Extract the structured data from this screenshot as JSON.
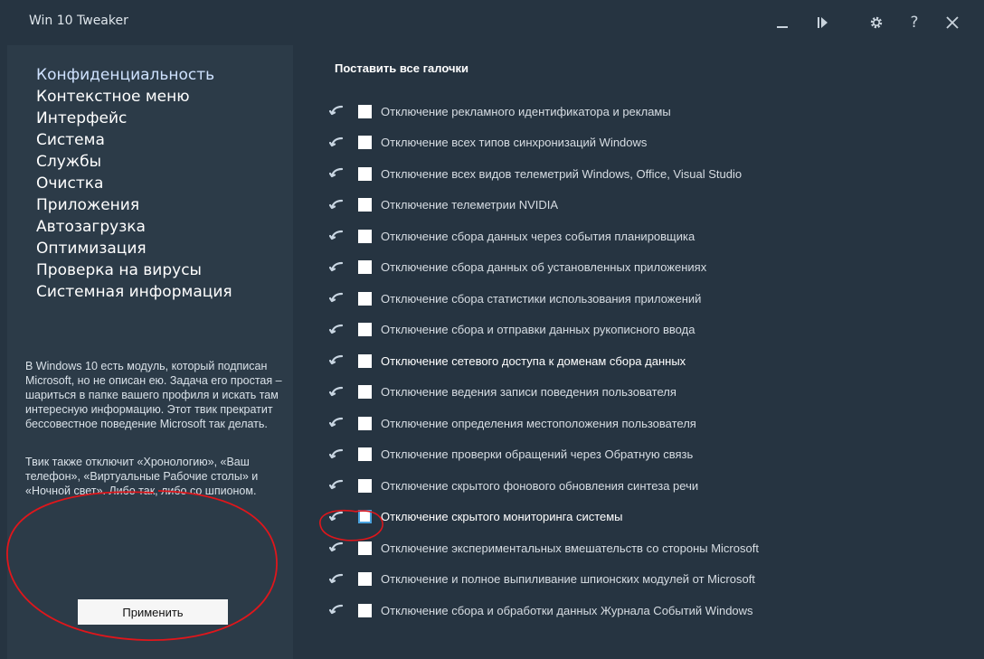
{
  "window": {
    "title": "Win 10 Tweaker"
  },
  "titlebar": {
    "buttons": [
      {
        "name": "minimize-icon"
      },
      {
        "name": "run-icon"
      },
      {
        "name": "gear-icon"
      },
      {
        "name": "help-icon"
      },
      {
        "name": "close-icon"
      }
    ]
  },
  "sidebar": {
    "items": [
      {
        "label": "Конфиденциальность"
      },
      {
        "label": "Контекстное меню"
      },
      {
        "label": "Интерфейс"
      },
      {
        "label": "Система"
      },
      {
        "label": "Службы"
      },
      {
        "label": "Очистка"
      },
      {
        "label": "Приложения"
      },
      {
        "label": "Автозагрузка"
      },
      {
        "label": "Оптимизация"
      },
      {
        "label": "Проверка на вирусы"
      },
      {
        "label": "Системная информация"
      }
    ],
    "description1": "В Windows 10 есть модуль, который подписан Microsoft, но не описан ею. Задача его простая – шариться в папке вашего профиля и искать там интересную информацию. Этот твик прекратит бессовестное поведение Microsoft так делать.",
    "description2": "Твик также отключит «Хронологию», «Ваш телефон», «Виртуальные Рабочие столы» и «Ночной свет». Либо так, либо со шпионом.",
    "apply_label": "Применить"
  },
  "main": {
    "check_all_label": "Поставить все галочки",
    "options": [
      {
        "label": "Отключение рекламного идентификатора и рекламы"
      },
      {
        "label": "Отключение всех типов синхронизаций Windows"
      },
      {
        "label": "Отключение всех видов телеметрий Windows, Office, Visual Studio"
      },
      {
        "label": "Отключение телеметрии NVIDIA"
      },
      {
        "label": "Отключение сбора данных через события планировщика"
      },
      {
        "label": "Отключение сбора данных об установленных приложениях"
      },
      {
        "label": "Отключение сбора статистики использования приложений"
      },
      {
        "label": "Отключение сбора и отправки данных рукописного ввода"
      },
      {
        "label": "Отключение сетевого доступа к доменам сбора данных"
      },
      {
        "label": "Отключение ведения записи поведения пользователя"
      },
      {
        "label": "Отключение определения местоположения пользователя"
      },
      {
        "label": "Отключение проверки обращений через Обратную связь"
      },
      {
        "label": "Отключение скрытого фонового обновления синтеза речи"
      },
      {
        "label": "Отключение скрытого мониторинга системы"
      },
      {
        "label": "Отключение экспериментальных вмешательств со стороны Microsoft"
      },
      {
        "label": "Отключение и полное выпиливание шпионских модулей от Microsoft"
      },
      {
        "label": "Отключение сбора и обработки данных Журнала Событий Windows"
      }
    ]
  },
  "colors": {
    "background": "#263441",
    "sidebar": "#2c3b48",
    "annotation": "#e0161b",
    "focus": "#4aa3df"
  }
}
